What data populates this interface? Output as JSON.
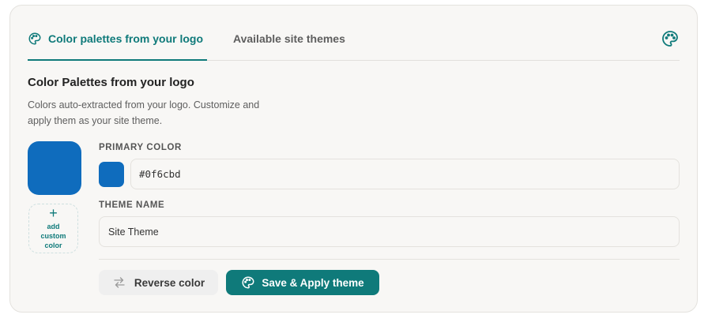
{
  "tabs": {
    "active_label": "Color palettes from your logo",
    "inactive_label": "Available site themes"
  },
  "section": {
    "title": "Color Palettes from your logo",
    "description": "Colors auto-extracted from your logo. Customize and apply them as your site theme."
  },
  "palette": {
    "swatch_color": "#0f6cbd",
    "add_custom_label": "add custom color"
  },
  "form": {
    "primary_label": "PRIMARY COLOR",
    "primary_value": "#0f6cbd",
    "theme_label": "THEME NAME",
    "theme_value": "Site Theme"
  },
  "actions": {
    "reverse_label": "Reverse color",
    "apply_label": "Save & Apply theme"
  },
  "colors": {
    "accent": "#0f7a7a",
    "primary": "#0f6cbd"
  },
  "icons": {
    "tab_icon": "palette-icon",
    "header_icon": "palette-icon",
    "reverse_icon": "swap-arrows-icon",
    "apply_icon": "palette-icon"
  }
}
